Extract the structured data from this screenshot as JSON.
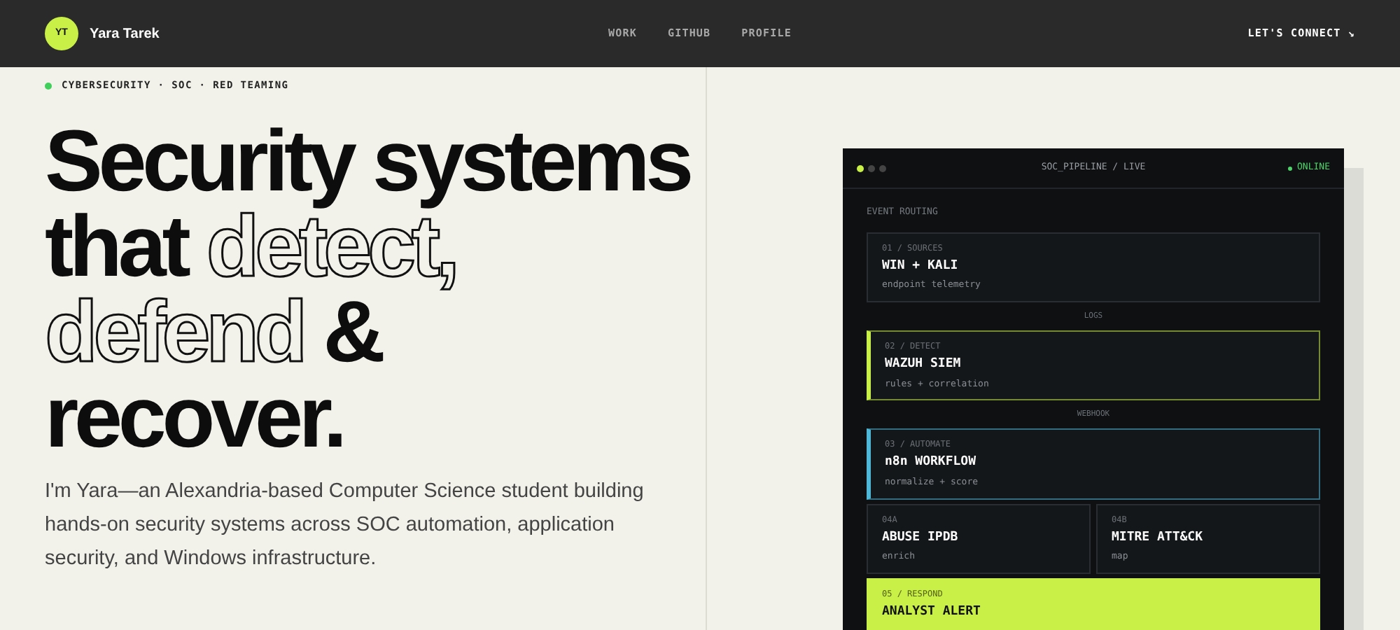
{
  "nav": {
    "avatar": "YT",
    "name": "Yara Tarek",
    "links": [
      "WORK",
      "GITHUB",
      "PROFILE"
    ],
    "cta": "LET'S CONNECT ↘"
  },
  "hero": {
    "eyebrow": "CYBERSECURITY · SOC · RED TEAMING",
    "headline": [
      [
        {
          "text": "Security systems",
          "outline": false
        }
      ],
      [
        {
          "text": "that ",
          "outline": false
        },
        {
          "text": "detect,",
          "outline": true
        }
      ],
      [
        {
          "text": "defend",
          "outline": true
        },
        {
          "text": " &",
          "outline": false
        }
      ],
      [
        {
          "text": "recover.",
          "outline": false
        }
      ]
    ],
    "intro": "I'm Yara—an Alexandria-based Computer Science student building hands-on security systems across SOC automation, application security, and Windows infrastructure."
  },
  "panel": {
    "title": "SOC_PIPELINE / LIVE",
    "status": "ONLINE",
    "section": "EVENT ROUTING",
    "steps": [
      {
        "kind": "node",
        "step": "01 / SOURCES",
        "name": "WIN + KALI",
        "detail": "endpoint telemetry"
      },
      {
        "kind": "connector",
        "label": "LOGS"
      },
      {
        "kind": "accent",
        "color": "#c8f046",
        "step": "02 / DETECT",
        "name": "WAZUH SIEM",
        "detail": "rules + correlation"
      },
      {
        "kind": "connector",
        "label": "WEBHOOK"
      },
      {
        "kind": "accent",
        "color": "#4fb8d8",
        "step": "03 / AUTOMATE",
        "name": "n8n WORKFLOW",
        "detail": "normalize + score"
      },
      {
        "kind": "pair",
        "items": [
          {
            "step": "04A",
            "name": "ABUSE IPDB",
            "detail": "enrich"
          },
          {
            "step": "04B",
            "name": "MITRE ATT&CK",
            "detail": "map"
          }
        ]
      },
      {
        "kind": "highlight",
        "step": "05 / RESPOND",
        "name": "ANALYST ALERT"
      }
    ]
  }
}
